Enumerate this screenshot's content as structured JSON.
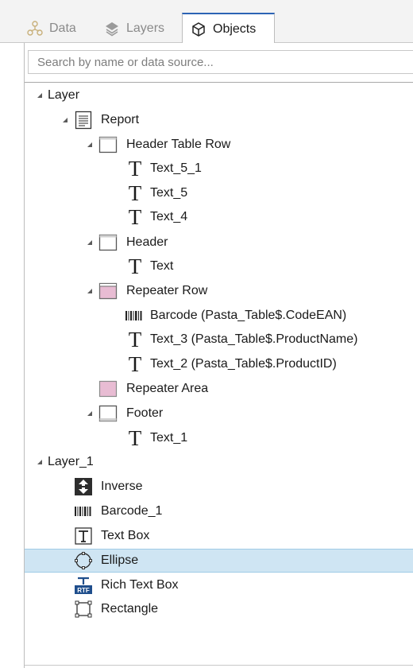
{
  "tabs": [
    {
      "label": "Data",
      "icon": "data-icon"
    },
    {
      "label": "Layers",
      "icon": "layers-icon"
    },
    {
      "label": "Objects",
      "icon": "objects-icon",
      "active": true
    }
  ],
  "search": {
    "placeholder": "Search by name or data source...",
    "value": ""
  },
  "tree": [
    {
      "label": "Layer",
      "icon": "none",
      "expanded": true
    },
    {
      "label": "Report",
      "icon": "report-icon",
      "expanded": true
    },
    {
      "label": "Header Table Row",
      "icon": "band-icon",
      "expanded": true
    },
    {
      "label": "Text_5_1",
      "icon": "text-icon"
    },
    {
      "label": "Text_5",
      "icon": "text-icon"
    },
    {
      "label": "Text_4",
      "icon": "text-icon"
    },
    {
      "label": "Header",
      "icon": "band-icon",
      "expanded": true
    },
    {
      "label": "Text",
      "icon": "text-icon"
    },
    {
      "label": "Repeater Row",
      "icon": "repeater-row-icon",
      "expanded": true
    },
    {
      "label": "Barcode (Pasta_Table$.CodeEAN)",
      "icon": "barcode-icon"
    },
    {
      "label": "Text_3 (Pasta_Table$.ProductName)",
      "icon": "text-icon"
    },
    {
      "label": "Text_2 (Pasta_Table$.ProductID)",
      "icon": "text-icon"
    },
    {
      "label": "Repeater Area",
      "icon": "repeater-area-icon"
    },
    {
      "label": "Footer",
      "icon": "footer-icon",
      "expanded": true
    },
    {
      "label": "Text_1",
      "icon": "text-icon"
    },
    {
      "label": "Layer_1",
      "icon": "none",
      "expanded": true
    },
    {
      "label": "Inverse",
      "icon": "inverse-icon"
    },
    {
      "label": "Barcode_1",
      "icon": "barcode-icon"
    },
    {
      "label": "Text Box",
      "icon": "textbox-icon"
    },
    {
      "label": "Ellipse",
      "icon": "ellipse-icon",
      "selected": true
    },
    {
      "label": "Rich Text Box",
      "icon": "rich-text-icon"
    },
    {
      "label": "Rectangle",
      "icon": "rectangle-icon"
    }
  ],
  "colors": {
    "selection": "#cfe5f3",
    "accent": "#2c64b5",
    "repeater": "#e8bcd3"
  }
}
